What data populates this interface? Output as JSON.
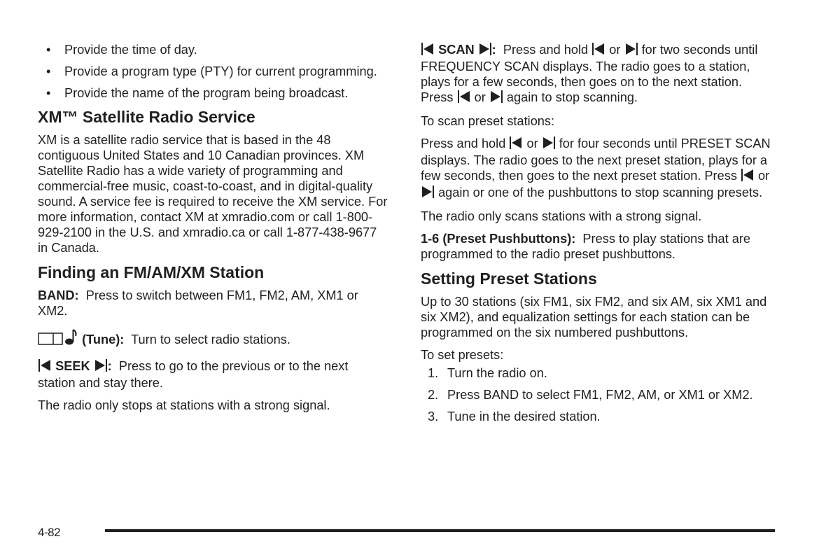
{
  "left_column": {
    "bullets": [
      "Provide the time of day.",
      "Provide a program type (PTY) for current programming.",
      "Provide the name of the program being broadcast."
    ],
    "xm_heading": "XM™ Satellite Radio Service",
    "xm_paragraph": "XM is a satellite radio service that is based in the 48 contiguous United States and 10 Canadian provinces. XM Satellite Radio has a wide variety of programming and commercial-free music, coast-to-coast, and in digital-quality sound. A service fee is required to receive the XM service. For more information, contact XM at xmradio.com or call 1-800-929-2100 in the U.S. and xmradio.ca or call 1-877-438-9677 in Canada.",
    "finding_heading": "Finding an FM/AM/XM Station",
    "band_term": "BAND:",
    "band_text": "Press to switch between FM1, FM2, AM, XM1 or XM2.",
    "tune_term": "(Tune):",
    "tune_text": "Turn to select radio stations.",
    "seek_term": "SEEK",
    "seek_colon": ":",
    "seek_text": "Press to go to the previous or to the next station and stay there.",
    "seek_note": "The radio only stops at stations with a strong signal."
  },
  "right_column": {
    "scan_term": "SCAN",
    "scan_colon": ":",
    "scan_text_1": "Press and hold",
    "scan_text_or": "or",
    "scan_text_2": "for two seconds until FREQUENCY SCAN displays. The radio goes to a station, plays for a few seconds, then goes on to the next station. Press",
    "scan_text_3": "again to stop scanning.",
    "scan_preset_intro": "To scan preset stations:",
    "preset_text_1": "Press and hold",
    "preset_text_2": "for four seconds until PRESET SCAN displays. The radio goes to the next preset station, plays for a few seconds, then goes to the next preset station. Press",
    "preset_text_3": "again or one of the pushbuttons to stop scanning presets.",
    "scan_note": "The radio only scans stations with a strong signal.",
    "pushbuttons_term": "1-6 (Preset Pushbuttons):",
    "pushbuttons_text": "Press to play stations that are programmed to the radio preset pushbuttons.",
    "setting_heading": "Setting Preset Stations",
    "setting_paragraph": "Up to 30 stations (six FM1, six FM2, and six AM, six XM1 and six XM2), and equalization settings for each station can be programmed on the six numbered pushbuttons.",
    "set_intro": "To set presets:",
    "steps": [
      {
        "num": "1.",
        "text": "Turn the radio on."
      },
      {
        "num": "2.",
        "text": "Press BAND to select FM1, FM2, AM, or XM1 or XM2."
      },
      {
        "num": "3.",
        "text": "Tune in the desired station."
      }
    ]
  },
  "footer": {
    "page_number": "4-82"
  },
  "icons": {
    "bullet": "•",
    "seek_back": "seek-back-icon",
    "seek_forward": "seek-forward-icon",
    "tune_knob": "tune-knob-icon",
    "music_note": "music-note-icon"
  }
}
